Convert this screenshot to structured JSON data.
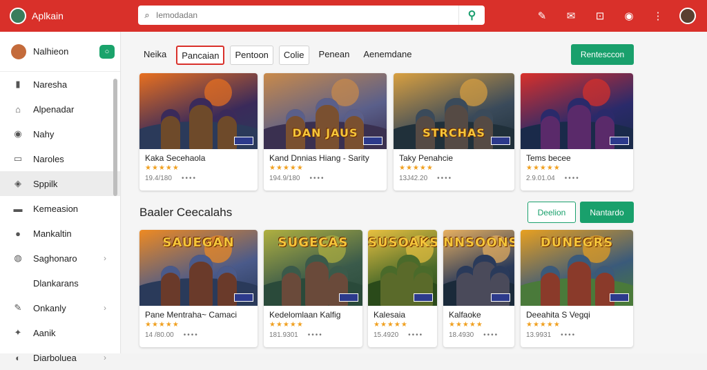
{
  "app": {
    "name": "Aplkain"
  },
  "search": {
    "placeholder": "Iemodadan"
  },
  "top_icons": [
    "help-icon",
    "chat-icon",
    "bookmark-icon",
    "notification-icon",
    "more-icon"
  ],
  "sidebar": {
    "user": "Nalhieon",
    "items": [
      {
        "label": "Naresha",
        "icon": "bookmark-icon"
      },
      {
        "label": "Alpenadar",
        "icon": "home-icon"
      },
      {
        "label": "Nahy",
        "icon": "location-icon"
      },
      {
        "label": "Naroles",
        "icon": "folder-icon"
      },
      {
        "label": "Sppilk",
        "icon": "tag-icon",
        "active": true
      },
      {
        "label": "Kemeasion",
        "icon": "card-icon"
      },
      {
        "label": "Mankaltin",
        "icon": "profile-icon"
      },
      {
        "label": "Saghonaro",
        "icon": "globe-icon",
        "chevron": true
      },
      {
        "label": "Dlankarans",
        "icon": ""
      },
      {
        "label": "Onkanly",
        "icon": "pen-icon",
        "chevron": true
      },
      {
        "label": "Aanik",
        "icon": "gamepad-icon"
      },
      {
        "label": "Diarboluea",
        "icon": "user-icon",
        "chevron": true
      }
    ]
  },
  "tabs": [
    "Neika",
    "Pancaian",
    "Pentoon",
    "Colie",
    "Penean",
    "Aenemdane"
  ],
  "buttons": {
    "top_action": "Rentesccon",
    "section_outline": "Deelion",
    "section_green": "Nantardo"
  },
  "section": {
    "title": "Baaler Ceecalahs"
  },
  "row1": [
    {
      "title": "Kaka Secehaola",
      "art_text": "",
      "stars": "★★★★★",
      "meta": "19.4/180",
      "palette": [
        "#e8701f",
        "#3a2a5a",
        "#6e4a2a",
        "#2b3a5a"
      ]
    },
    {
      "title": "Kand Dnnias Hiang - Sarity",
      "art_text": "DAN JAUS",
      "stars": "★★★★★",
      "meta": "194.9/180",
      "palette": [
        "#c98a4a",
        "#5a5f8a",
        "#7a5030",
        "#3a3050"
      ]
    },
    {
      "title": "Taky Penahcie",
      "art_text": "STRCHAS",
      "stars": "★★★★★",
      "meta": "13J42.20",
      "palette": [
        "#d9a040",
        "#3a4a5a",
        "#554a44",
        "#20303a"
      ]
    },
    {
      "title": "Tems becee",
      "art_text": "",
      "stars": "★★★★★",
      "meta": "2.9.01.04",
      "palette": [
        "#d9302a",
        "#2a2a6a",
        "#5a2a6a",
        "#1a2a4a"
      ]
    }
  ],
  "row2": [
    {
      "title": "Pane Mentraha~ Camaci",
      "art_text": "SAUEGAN",
      "stars": "★★★★★",
      "meta": "14 /80.00",
      "palette": [
        "#ee8a22",
        "#4a5a8a",
        "#6a3a2a",
        "#2a3a5a"
      ]
    },
    {
      "title": "Kedelomlaan Kalfig",
      "art_text": "SUGECAS",
      "stars": "★★★★★",
      "meta": "181.9301",
      "palette": [
        "#b0b040",
        "#3a5a4a",
        "#6a4a3a",
        "#2a4a3a"
      ]
    },
    {
      "title": "Kalesaia",
      "art_text": "SUSOAKS",
      "stars": "★★★★★",
      "meta": "15.4920",
      "palette": [
        "#e8c040",
        "#4a6a2a",
        "#5a6a2a",
        "#2a4a1a"
      ]
    },
    {
      "title": "Kalfaoke",
      "art_text": "NNSOONS",
      "stars": "★★★★★",
      "meta": "18.4930",
      "palette": [
        "#e8b060",
        "#2a3a5a",
        "#4a4a5a",
        "#1a2a3a"
      ]
    },
    {
      "title": "Deeahita S Vegqi",
      "art_text": "DUNEGRS",
      "stars": "★★★★★",
      "meta": "13.9931",
      "palette": [
        "#e8a020",
        "#3a5a7a",
        "#8a3a2a",
        "#4a7a3a"
      ]
    }
  ]
}
